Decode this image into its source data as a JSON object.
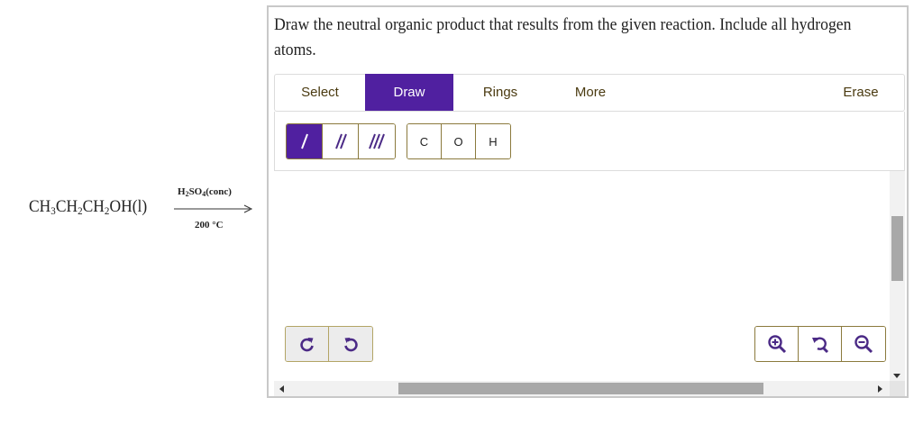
{
  "reaction": {
    "reactant_parts": [
      "CH",
      "3",
      "CH",
      "2",
      "CH",
      "2",
      "OH(l)"
    ],
    "reagent_parts": [
      "H",
      "2",
      "SO",
      "4",
      "(conc)"
    ],
    "conditions": "200 °C"
  },
  "question": {
    "prompt": "Draw the neutral organic product that results from the given reaction. Include all hydrogen atoms."
  },
  "toolbar": {
    "tabs": [
      {
        "label": "Select",
        "active": false
      },
      {
        "label": "Draw",
        "active": true
      },
      {
        "label": "Rings",
        "active": false
      },
      {
        "label": "More",
        "active": false
      },
      {
        "label": "Erase",
        "active": false
      }
    ]
  },
  "palette": {
    "bonds": [
      {
        "icon": "single-bond-icon",
        "active": true
      },
      {
        "icon": "double-bond-icon",
        "active": false
      },
      {
        "icon": "triple-bond-icon",
        "active": false
      }
    ],
    "atoms": [
      "C",
      "O",
      "H"
    ]
  },
  "canvas_controls": {
    "history": [
      {
        "icon": "undo-icon"
      },
      {
        "icon": "redo-icon"
      }
    ],
    "zoom": [
      {
        "icon": "zoom-in-icon"
      },
      {
        "icon": "reset-view-icon"
      },
      {
        "icon": "zoom-out-icon"
      }
    ]
  },
  "colors": {
    "accent": "#5020a0",
    "button_border": "#8b7a3d",
    "icon": "#4b2a86"
  }
}
